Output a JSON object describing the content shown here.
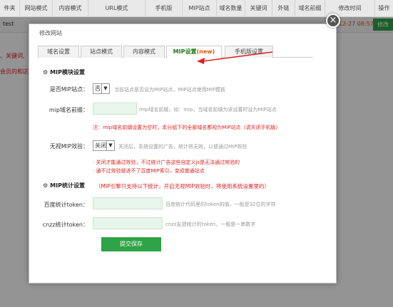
{
  "background_table": {
    "columns": [
      "件夹",
      "网站模式",
      "内容模式",
      "URL模式",
      "手机版",
      "MIP站点",
      "域名数量",
      "关键词",
      "外链",
      "域名前缀",
      "修改时间",
      "操作"
    ],
    "row_text": "test",
    "row_date": "12-27 08:57",
    "edit_label": "修改",
    "left_text_1": "、关键词,",
    "left_text_2": "会员的和这"
  },
  "modal": {
    "title": "修改网站",
    "close_symbol": "×",
    "tabs": [
      {
        "label": "域名设置"
      },
      {
        "label": "站点模式"
      },
      {
        "label": "内容模式"
      },
      {
        "label": "MIP设置",
        "badge": "(new)"
      },
      {
        "label": "手机版设置"
      }
    ],
    "mip_section": {
      "title": "MIP模块设置",
      "is_mip_label": "是否MIP站点：",
      "is_mip_value": "否",
      "is_mip_hint": "当前站点是否设为MIP站点，MIP站点使用MIP模板",
      "prefix_label": "mip域名前缀：",
      "prefix_value": "",
      "prefix_hint": "mip域名前缀，如：mip，当域名前缀为该设置时设为MIP站点",
      "prefix_warn": "注：mip域名前缀设置为空时，本分组下的全部域名都视为MIP站点（请关闭手机版）",
      "invalid_label": "无视MIP效验：",
      "invalid_value": "关闭",
      "invalid_hint": "关闭后，系统设置的广告，统计将无效，以便通过MIP效验",
      "invalid_warn_1": "· 关闭才能通过效验，不过统计广告这些自定义js是无法通过效验的",
      "invalid_warn_2": "· 通不过效验就进不了百度MIP索引，变成普通站点"
    },
    "stats_section": {
      "title": "MIP统计设置",
      "note": "（MIP引擎只支持以下统计，开启无视MIP效验时，将使用系统设置里的）",
      "baidu_label": "百度统计token：",
      "baidu_value": "",
      "baidu_hint": "百度统计代码里的token的值，一般是32位的字符",
      "cnzz_label": "cnzz统计token：",
      "cnzz_value": "",
      "cnzz_hint": "cnzz友盟统计的token，一般是一串数字"
    },
    "submit_label": "提交保存"
  },
  "colors": {
    "accent_green": "#2fa347",
    "warning_red": "#dd2222",
    "new_badge": "#e05a00",
    "input_bg": "#e8f5ea"
  },
  "icons": [
    "gear-icon",
    "close-icon",
    "chevron-down-icon",
    "arrow-annotation"
  ]
}
